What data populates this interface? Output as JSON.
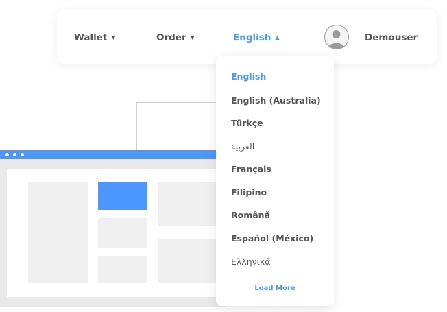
{
  "navbar": {
    "wallet_label": "Wallet",
    "order_label": "Order",
    "language_label": "English",
    "username": "Demouser"
  },
  "language_menu": {
    "items": [
      {
        "label": "English",
        "selected": true
      },
      {
        "label": "English (Australia)"
      },
      {
        "label": "Türkçe"
      },
      {
        "label": "العربية"
      },
      {
        "label": "Français"
      },
      {
        "label": "Filipino"
      },
      {
        "label": "Română"
      },
      {
        "label": "Español (México)"
      },
      {
        "label": "Ελληνικά"
      }
    ],
    "load_more_label": "Load More"
  },
  "icons": {
    "dropdown_caret": "caret-down-icon",
    "open_caret": "caret-up-icon",
    "avatar": "user-avatar-icon"
  },
  "colors": {
    "accent": "#4b97ff",
    "text": "#555555",
    "placeholder_block": "#efefef"
  }
}
